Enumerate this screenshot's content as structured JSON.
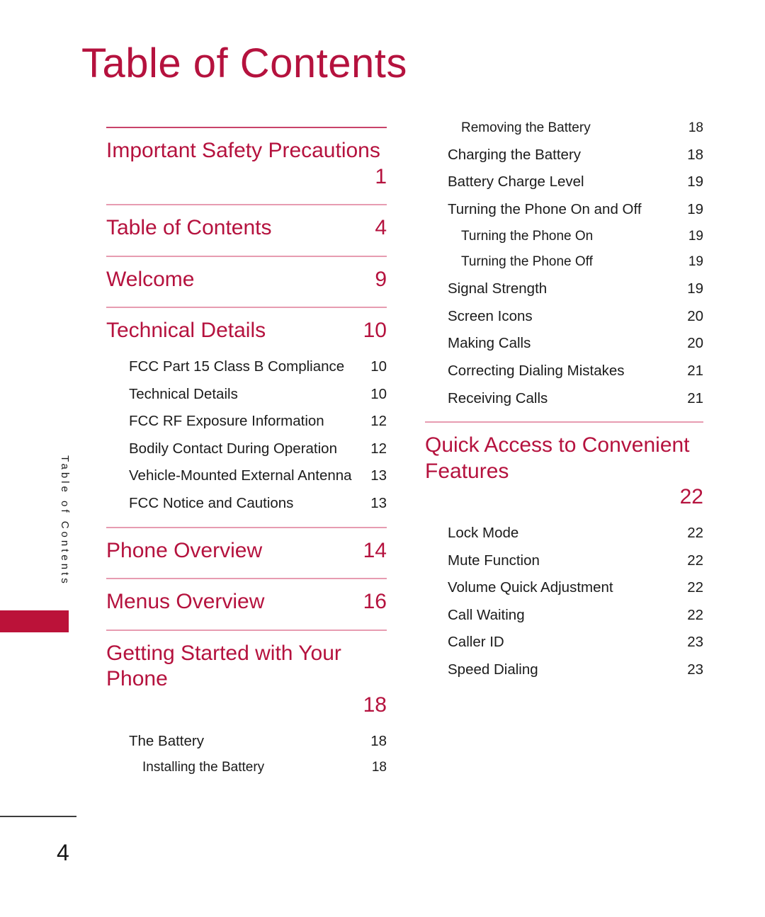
{
  "page": {
    "title": "Table of Contents",
    "page_number": "4",
    "side_tab_label": "Table of Contents",
    "accent_color": "#B5123E",
    "rule_color": "#E79CB1",
    "tab_block_color": "#BB1239"
  },
  "columns": {
    "left": [
      {
        "kind": "rule",
        "style": "strong"
      },
      {
        "kind": "entry",
        "level": 1,
        "wrap": true,
        "label": "Important Safety Precautions",
        "page": "1"
      },
      {
        "kind": "rule",
        "style": "plain"
      },
      {
        "kind": "entry",
        "level": 1,
        "label": "Table of Contents",
        "page": "4"
      },
      {
        "kind": "rule",
        "style": "plain"
      },
      {
        "kind": "entry",
        "level": 1,
        "label": "Welcome",
        "page": "9"
      },
      {
        "kind": "rule",
        "style": "plain"
      },
      {
        "kind": "entry",
        "level": 1,
        "label": "Technical Details",
        "page": "10"
      },
      {
        "kind": "entry",
        "level": 2,
        "label": "FCC Part 15 Class B Compliance",
        "page": "10"
      },
      {
        "kind": "entry",
        "level": 2,
        "label": "Technical Details",
        "page": "10"
      },
      {
        "kind": "entry",
        "level": 2,
        "label": "FCC RF Exposure Information",
        "page": "12"
      },
      {
        "kind": "entry",
        "level": 2,
        "label": "Bodily Contact During Operation",
        "page": "12"
      },
      {
        "kind": "entry",
        "level": 2,
        "label": "Vehicle-Mounted External Antenna",
        "page": "13"
      },
      {
        "kind": "entry",
        "level": 2,
        "label": "FCC Notice and Cautions",
        "page": "13"
      },
      {
        "kind": "rule",
        "style": "plain"
      },
      {
        "kind": "entry",
        "level": 1,
        "label": "Phone Overview",
        "page": "14"
      },
      {
        "kind": "rule",
        "style": "plain"
      },
      {
        "kind": "entry",
        "level": 1,
        "label": "Menus Overview",
        "page": "16"
      },
      {
        "kind": "rule",
        "style": "plain"
      },
      {
        "kind": "entry",
        "level": 1,
        "wrap": true,
        "label": "Getting Started with Your Phone",
        "page": "18"
      },
      {
        "kind": "entry",
        "level": 2,
        "label": "The Battery",
        "page": "18"
      },
      {
        "kind": "entry",
        "level": 3,
        "label": "Installing the Battery",
        "page": "18"
      }
    ],
    "right": [
      {
        "kind": "entry",
        "level": 3,
        "label": "Removing the Battery",
        "page": "18"
      },
      {
        "kind": "entry",
        "level": 2,
        "label": "Charging the Battery",
        "page": "18"
      },
      {
        "kind": "entry",
        "level": 2,
        "label": "Battery Charge Level",
        "page": "19"
      },
      {
        "kind": "entry",
        "level": 2,
        "label": "Turning the Phone On and Off",
        "page": "19"
      },
      {
        "kind": "entry",
        "level": 3,
        "label": "Turning the Phone On",
        "page": "19"
      },
      {
        "kind": "entry",
        "level": 3,
        "label": "Turning the Phone Off",
        "page": "19"
      },
      {
        "kind": "entry",
        "level": 2,
        "label": "Signal Strength",
        "page": "19"
      },
      {
        "kind": "entry",
        "level": 2,
        "label": "Screen Icons",
        "page": "20"
      },
      {
        "kind": "entry",
        "level": 2,
        "label": "Making Calls",
        "page": "20"
      },
      {
        "kind": "entry",
        "level": 2,
        "label": "Correcting Dialing Mistakes",
        "page": "21"
      },
      {
        "kind": "entry",
        "level": 2,
        "label": "Receiving Calls",
        "page": "21"
      },
      {
        "kind": "rule",
        "style": "plain"
      },
      {
        "kind": "entry",
        "level": 1,
        "wrap": true,
        "label": "Quick Access to Convenient Features",
        "page": "22"
      },
      {
        "kind": "entry",
        "level": 2,
        "label": "Lock Mode",
        "page": "22"
      },
      {
        "kind": "entry",
        "level": 2,
        "label": "Mute Function",
        "page": "22"
      },
      {
        "kind": "entry",
        "level": 2,
        "label": "Volume Quick Adjustment",
        "page": "22"
      },
      {
        "kind": "entry",
        "level": 2,
        "label": "Call Waiting",
        "page": "22"
      },
      {
        "kind": "entry",
        "level": 2,
        "label": "Caller ID",
        "page": "23"
      },
      {
        "kind": "entry",
        "level": 2,
        "label": "Speed Dialing",
        "page": "23"
      }
    ]
  }
}
